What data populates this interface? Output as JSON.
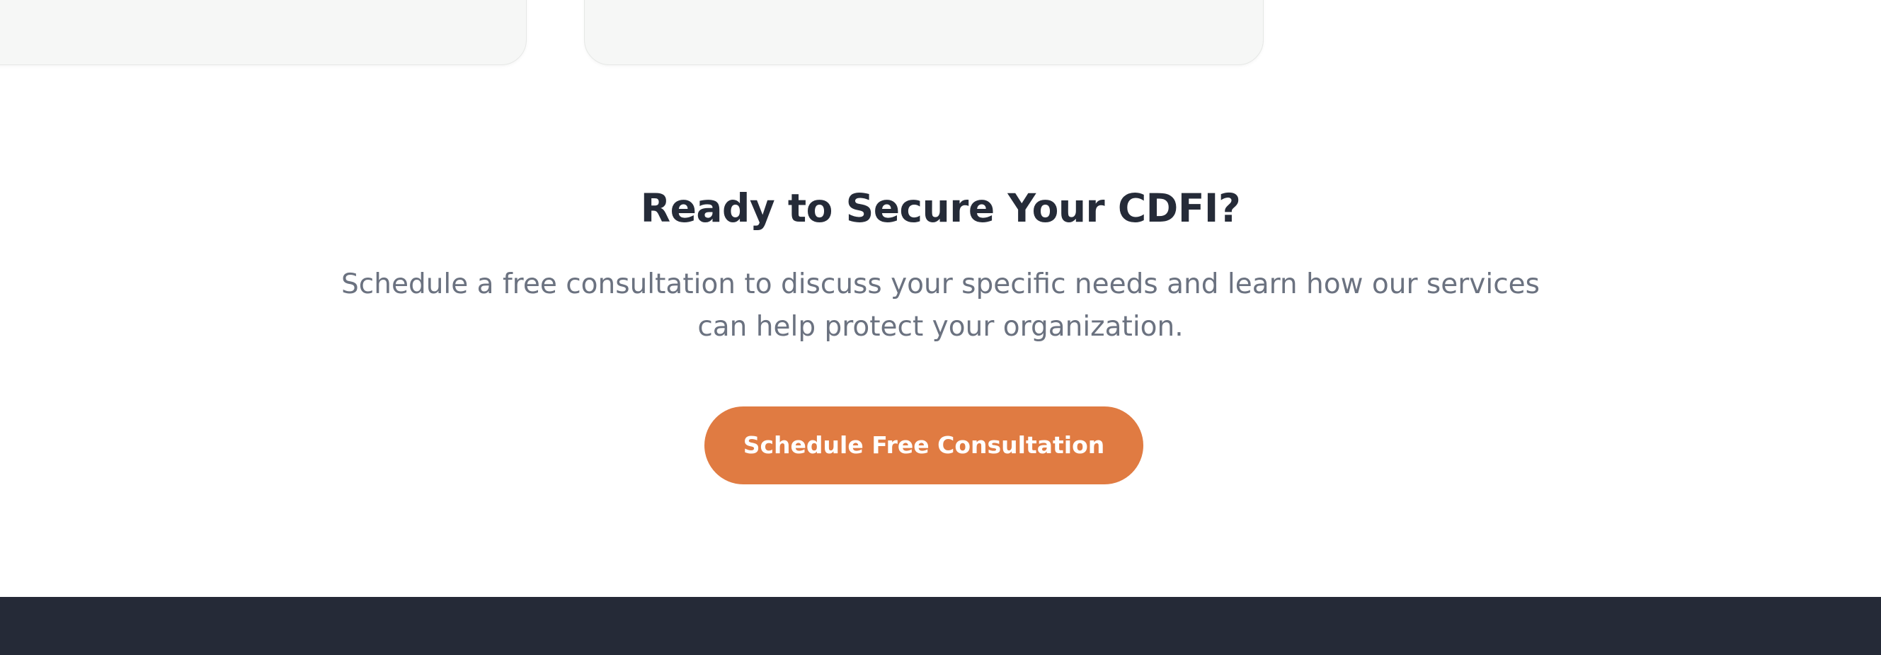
{
  "cta": {
    "title": "Ready to Secure Your CDFI?",
    "description": "Schedule a free consultation to discuss your specific needs and learn how our services can help protect your organization.",
    "button_label": "Schedule Free Consultation"
  },
  "colors": {
    "background": "#ffffff",
    "card_background": "#f6f7f6",
    "title": "#252b38",
    "description": "#6b7280",
    "accent": "#e07b42",
    "footer": "#252a37"
  }
}
